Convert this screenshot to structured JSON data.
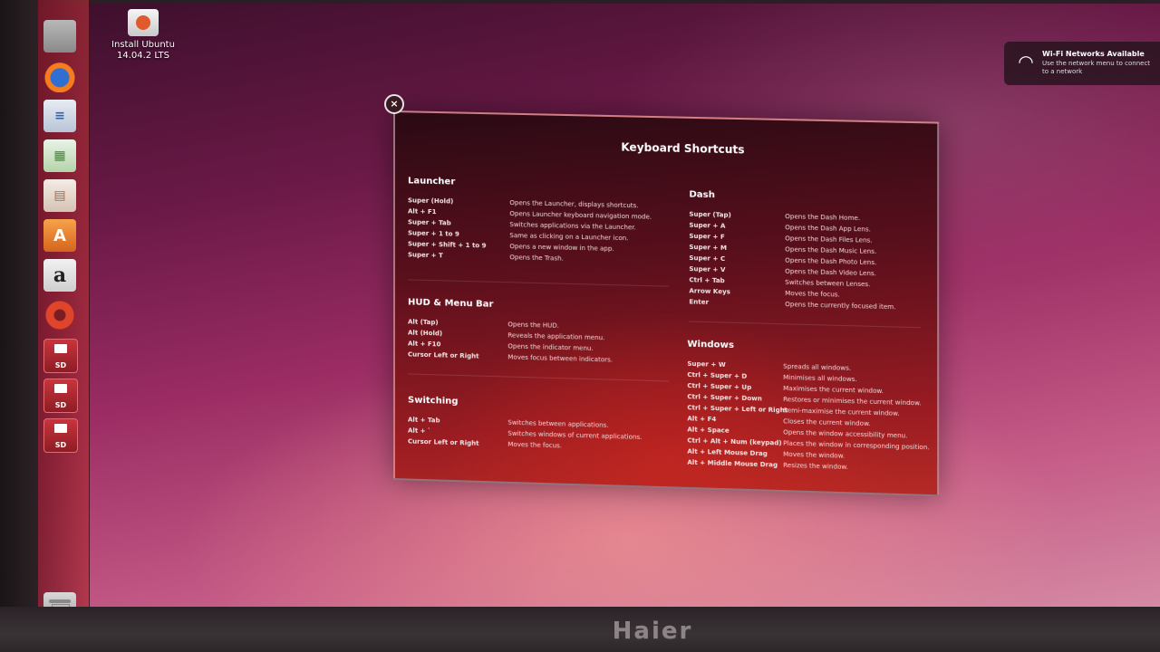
{
  "desktop": {
    "icon_label_line1": "Install Ubuntu",
    "icon_label_line2": "14.04.2 LTS"
  },
  "notification": {
    "title": "Wi-Fi Networks Available",
    "body": "Use the network menu to connect to a network"
  },
  "brand": "Haier",
  "launcher": {
    "items": [
      {
        "name": "files-icon"
      },
      {
        "name": "firefox-icon"
      },
      {
        "name": "writer-icon",
        "glyph": "≡"
      },
      {
        "name": "calc-icon",
        "glyph": "▦"
      },
      {
        "name": "impress-icon",
        "glyph": "▤"
      },
      {
        "name": "software-center-icon",
        "glyph": "A"
      },
      {
        "name": "amazon-icon",
        "glyph": "a"
      },
      {
        "name": "settings-icon"
      },
      {
        "name": "sd-card-icon",
        "label": "SD"
      },
      {
        "name": "sd-card-icon",
        "label": "SD"
      },
      {
        "name": "sd-card-icon",
        "label": "SD"
      },
      {
        "name": "trash-icon"
      }
    ]
  },
  "overlay": {
    "title": "Keyboard Shortcuts",
    "close_glyph": "×",
    "launcher": {
      "title": "Launcher",
      "rows": [
        {
          "k": "Super (Hold)",
          "d": "Opens the Launcher, displays shortcuts."
        },
        {
          "k": "Alt + F1",
          "d": "Opens Launcher keyboard navigation mode."
        },
        {
          "k": "Super + Tab",
          "d": "Switches applications via the Launcher."
        },
        {
          "k": "Super + 1 to 9",
          "d": "Same as clicking on a Launcher icon."
        },
        {
          "k": "Super + Shift + 1 to 9",
          "d": "Opens a new window in the app."
        },
        {
          "k": "Super + T",
          "d": "Opens the Trash."
        }
      ]
    },
    "hud": {
      "title": "HUD & Menu Bar",
      "rows": [
        {
          "k": "Alt (Tap)",
          "d": "Opens the HUD."
        },
        {
          "k": "Alt (Hold)",
          "d": "Reveals the application menu."
        },
        {
          "k": "Alt + F10",
          "d": "Opens the indicator menu."
        },
        {
          "k": "Cursor Left or Right",
          "d": "Moves focus between indicators."
        }
      ]
    },
    "switching": {
      "title": "Switching",
      "rows": [
        {
          "k": "Alt + Tab",
          "d": "Switches between applications."
        },
        {
          "k": "Alt + `",
          "d": "Switches windows of current applications."
        },
        {
          "k": "Cursor Left or Right",
          "d": "Moves the focus."
        }
      ]
    },
    "dash": {
      "title": "Dash",
      "rows": [
        {
          "k": "Super (Tap)",
          "d": "Opens the Dash Home."
        },
        {
          "k": "Super + A",
          "d": "Opens the Dash App Lens."
        },
        {
          "k": "Super + F",
          "d": "Opens the Dash Files Lens."
        },
        {
          "k": "Super + M",
          "d": "Opens the Dash Music Lens."
        },
        {
          "k": "Super + C",
          "d": "Opens the Dash Photo Lens."
        },
        {
          "k": "Super + V",
          "d": "Opens the Dash Video Lens."
        },
        {
          "k": "Ctrl + Tab",
          "d": "Switches between Lenses."
        },
        {
          "k": "Arrow Keys",
          "d": "Moves the focus."
        },
        {
          "k": "Enter",
          "d": "Opens the currently focused item."
        }
      ]
    },
    "windows": {
      "title": "Windows",
      "rows": [
        {
          "k": "Super + W",
          "d": "Spreads all windows."
        },
        {
          "k": "Ctrl + Super + D",
          "d": "Minimises all windows."
        },
        {
          "k": "Ctrl + Super + Up",
          "d": "Maximises the current window."
        },
        {
          "k": "Ctrl + Super + Down",
          "d": "Restores or minimises the current window."
        },
        {
          "k": "Ctrl + Super + Left or Right",
          "d": "Semi-maximise the current window."
        },
        {
          "k": "Alt + F4",
          "d": "Closes the current window."
        },
        {
          "k": "Alt + Space",
          "d": "Opens the window accessibility menu."
        },
        {
          "k": "Ctrl + Alt + Num (keypad)",
          "d": "Places the window in corresponding position."
        },
        {
          "k": "Alt + Left Mouse Drag",
          "d": "Moves the window."
        },
        {
          "k": "Alt + Middle Mouse Drag",
          "d": "Resizes the window."
        }
      ]
    }
  }
}
